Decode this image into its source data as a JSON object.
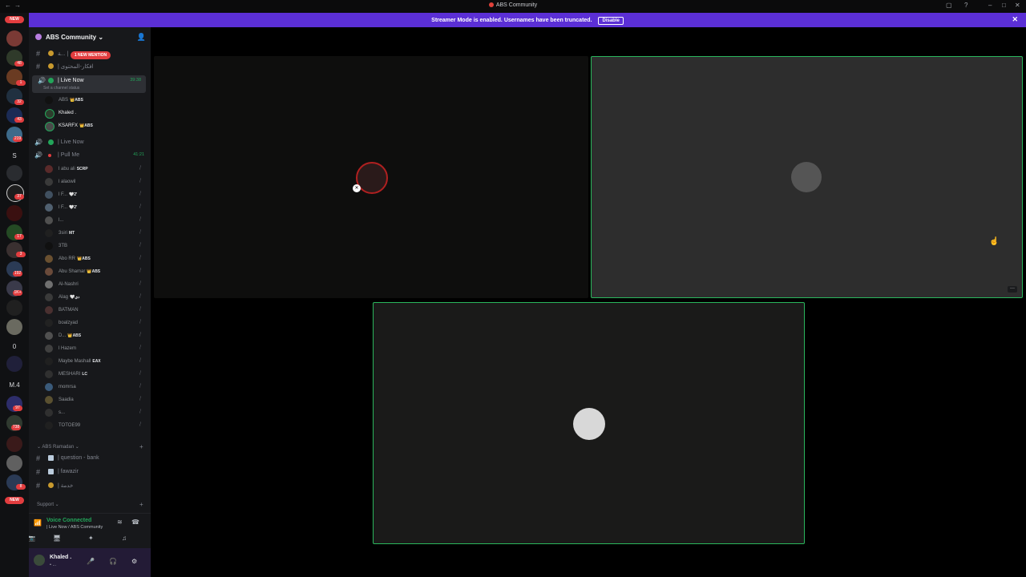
{
  "window": {
    "title": "ABS Community"
  },
  "banner": {
    "message": "Streamer Mode is enabled. Usernames have been truncated.",
    "disable_label": "Disable"
  },
  "rail": {
    "new_top": "NEW",
    "new_bottom": "NEW",
    "badges": [
      "48",
      "1",
      "32",
      "43",
      "219",
      "37",
      "17",
      "3",
      "192",
      "1K+",
      "97",
      "738",
      "8"
    ],
    "zero_label": "0",
    "m4_label": "M.4"
  },
  "guild": {
    "name": "ABS Community ⌄"
  },
  "channels": {
    "mention_pill": "1 NEW MENTION",
    "text_1": "ﺔ... |",
    "text_2": "| افكار-المحتوى",
    "live_now": "| Live Now",
    "live_now_time": "39:38",
    "live_now_status": "Set a channel status",
    "live_now_2": "| Live Now",
    "pull_me": "| Pull Me",
    "pull_me_time": "41:21"
  },
  "live_members": [
    {
      "name": "ABS",
      "tag": "👑ABS"
    },
    {
      "name": "Khaled .",
      "tag": ""
    },
    {
      "name": "KSARFX",
      "tag": "👑ABS"
    }
  ],
  "pull_members": [
    {
      "name": "l abu ali",
      "tag": "SCRP"
    },
    {
      "name": "l alaowil",
      "tag": ""
    },
    {
      "name": "l F...",
      "tag": "🤍2'"
    },
    {
      "name": "l F...",
      "tag": "🤍2'"
    },
    {
      "name": "l...",
      "tag": ""
    },
    {
      "name": "3siri",
      "tag": "MT"
    },
    {
      "name": "3TB",
      "tag": ""
    },
    {
      "name": "Abo RR",
      "tag": "👑ABS"
    },
    {
      "name": "Abu Shamar",
      "tag": "👑ABS"
    },
    {
      "name": "Al-Nashri",
      "tag": ""
    },
    {
      "name": "Alag",
      "tag": "🤍دي"
    },
    {
      "name": "BATMAN",
      "tag": ""
    },
    {
      "name": "boalzyad",
      "tag": ""
    },
    {
      "name": "D...",
      "tag": "👑ABS"
    },
    {
      "name": "l Hazem",
      "tag": ""
    },
    {
      "name": "Maybe Mashall",
      "tag": "EAX"
    },
    {
      "name": "MESHARI",
      "tag": "LC"
    },
    {
      "name": "momrsa",
      "tag": ""
    },
    {
      "name": "Saadia",
      "tag": ""
    },
    {
      "name": "s...",
      "tag": ""
    },
    {
      "name": "TOTOE99",
      "tag": ""
    }
  ],
  "categories": {
    "ramadan": "⌄ ABS Ramadan ⌄",
    "support": "Support ⌄"
  },
  "ramadan_channels": {
    "question_bank": "| question - bank",
    "fawazir": "| fawazir",
    "third": "| خدمة"
  },
  "voice": {
    "connected": "Voice Connected",
    "location": "| Live Now / ABS Community"
  },
  "user": {
    "name": "Khaled .",
    "status": "• ..."
  },
  "icons": {
    "hash": "#",
    "speaker": "🔊",
    "mute": "🎙",
    "signal": "📶",
    "disconnect": "☎",
    "camera": "📷",
    "screen": "🖥",
    "activity": "✦",
    "soundboard": "♫",
    "mic": "🎤",
    "headset": "🎧",
    "gear": "⚙",
    "add_user": "👤",
    "close": "✕",
    "more": "···",
    "cursor": "☝",
    "plus": "+"
  },
  "colors": {
    "accent": "#5b2fd6",
    "speaking_border": "#2ab65c",
    "live_green": "#23a55a",
    "mention_red": "#e23d3f"
  }
}
